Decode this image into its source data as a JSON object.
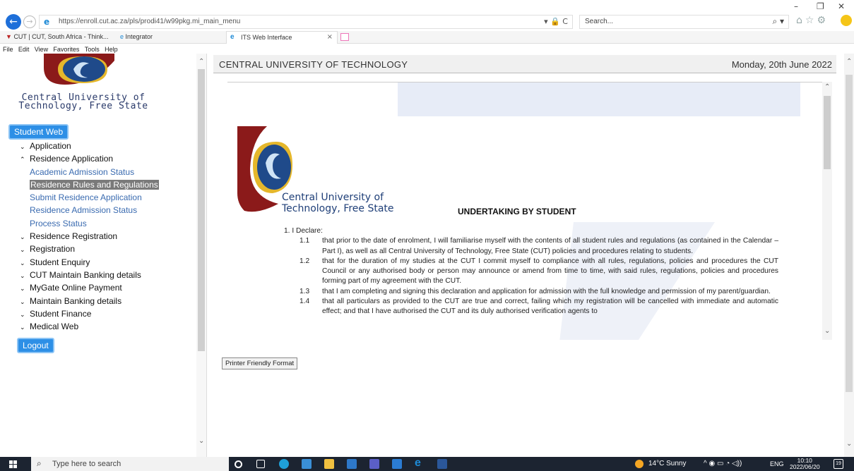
{
  "browser": {
    "url": "https://enroll.cut.ac.za/pls/prodi41/w99pkg.mi_main_menu",
    "url_tools": "▾ 🔒 C",
    "search_placeholder": "Search...",
    "search_tools": "⌕ ▾",
    "window_controls": {
      "minimize": "–",
      "restore": "❐",
      "close": "✕"
    },
    "toolbar_icons": "⌂☆⚙"
  },
  "favorites": [
    {
      "label": "CUT | CUT, South Africa - Think..."
    },
    {
      "label": "Integrator"
    }
  ],
  "tabs": [
    {
      "label": "ITS Web Interface",
      "close": "×"
    }
  ],
  "menu": [
    "File",
    "Edit",
    "View",
    "Favorites",
    "Tools",
    "Help"
  ],
  "sidebar": {
    "institution_line1": "Central University of",
    "institution_line2": "Technology, Free State",
    "home_button": "Student Web",
    "logout_button": "Logout",
    "items": [
      {
        "label": "Application",
        "chevron": "⌄",
        "expanded": false
      },
      {
        "label": "Residence Application",
        "chevron": "⌃",
        "expanded": true
      },
      {
        "label": "Academic Admission Status",
        "sub": true
      },
      {
        "label": "Residence Rules and Regulations",
        "sub": true,
        "selected": true
      },
      {
        "label": "Submit Residence Application",
        "sub": true
      },
      {
        "label": "Residence Admission Status",
        "sub": true
      },
      {
        "label": "Process Status",
        "sub": true
      },
      {
        "label": "Residence Registration",
        "chevron": "⌄"
      },
      {
        "label": "Registration",
        "chevron": "⌄"
      },
      {
        "label": "Student Enquiry",
        "chevron": "⌄"
      },
      {
        "label": "CUT Maintain Banking details",
        "chevron": "⌄"
      },
      {
        "label": "MyGate Online Payment",
        "chevron": "⌄"
      },
      {
        "label": "Maintain Banking details",
        "chevron": "⌄"
      },
      {
        "label": "Student Finance",
        "chevron": "⌄"
      },
      {
        "label": "Medical Web",
        "chevron": "⌄"
      }
    ]
  },
  "header": {
    "title": "CENTRAL UNIVERSITY OF TECHNOLOGY",
    "date": "Monday, 20th June 2022"
  },
  "document": {
    "logo_line1": "Central University of",
    "logo_line2": "Technology, Free State",
    "title": "UNDERTAKING BY STUDENT",
    "declare": "1.   I Declare:",
    "clauses": [
      {
        "num": "1.1",
        "text": "that prior to the date of enrolment, I will familiarise myself with the contents of all student rules and regulations (as contained in the Calendar – Part I), as well as all Central University of Technology, Free State (CUT) policies and procedures relating to students."
      },
      {
        "num": "1.2",
        "text": "that for the duration of my studies at the CUT I commit myself to compliance with all rules, regulations, policies and procedures the CUT Council or any authorised body or person may announce or amend from time to time, with said rules, regulations, policies and procedures forming part of my agreement with the CUT."
      },
      {
        "num": "1.3",
        "text": "that I am completing and signing this declaration and application for admission with the full knowledge and permission of my parent/guardian."
      },
      {
        "num": "1.4",
        "text": "that all particulars as provided to the CUT are true and correct, failing which my registration will be cancelled with immediate and automatic effect; and that I have authorised the CUT and its duly authorised verification agents to"
      }
    ],
    "printer_button": "Printer Friendly Format"
  },
  "taskbar": {
    "search_placeholder": "Type here to search",
    "weather": "14°C  Sunny",
    "tray_icons": "^  ◉  ▭  ◔  ◁))",
    "language": "ENG",
    "time": "10:10",
    "date": "2022/06/20",
    "notifications": "19"
  },
  "colors": {
    "accent_blue": "#2d8fe6",
    "link_blue": "#3a6bb0",
    "logo_red": "#8b1a1a",
    "logo_gold": "#e5b72b",
    "logo_navy": "#1f3f78"
  }
}
